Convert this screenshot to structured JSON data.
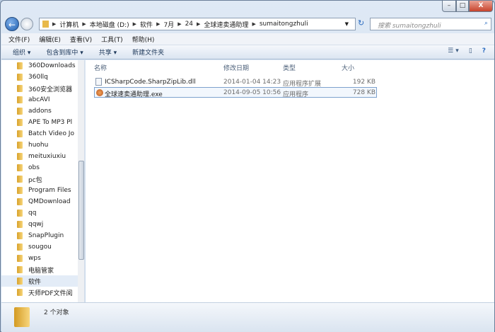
{
  "window": {
    "minimize": "–",
    "maximize": "□",
    "close": "X"
  },
  "address": {
    "parts": [
      "计算机",
      "本地磁盘 (D:)",
      "软件",
      "7月",
      "24",
      "全球速卖通助理",
      "sumaitongzhuli"
    ]
  },
  "search": {
    "placeholder": "搜索 sumaitongzhuli"
  },
  "menu": [
    "文件(F)",
    "编辑(E)",
    "查看(V)",
    "工具(T)",
    "帮助(H)"
  ],
  "toolbar": {
    "organize": "组织 ▾",
    "include": "包含到库中 ▾",
    "share": "共享 ▾",
    "new_folder": "新建文件夹"
  },
  "sidebar": [
    "360Downloads",
    "360llq",
    "360安全浏览器",
    "abcAVI",
    "addons",
    "APE To MP3 Pl",
    "Batch Video Jo",
    "huohu",
    "meituxiuxiu",
    "obs",
    "pc包",
    "Program Files",
    "QMDownload",
    "qq",
    "qqwj",
    "SnapPlugin",
    "sougou",
    "wps",
    "电脑管家",
    "软件",
    "天师PDF文件阅"
  ],
  "columns": {
    "name": "名称",
    "date": "修改日期",
    "type": "类型",
    "size": "大小"
  },
  "files": [
    {
      "name": "ICSharpCode.SharpZipLib.dll",
      "date": "2014-01-04 14:23",
      "type": "应用程序扩展",
      "size": "192 KB"
    },
    {
      "name": "全球速卖通助理.exe",
      "date": "2014-09-05 10:56",
      "type": "应用程序",
      "size": "728 KB"
    }
  ],
  "status": {
    "count": "2 个对象"
  }
}
